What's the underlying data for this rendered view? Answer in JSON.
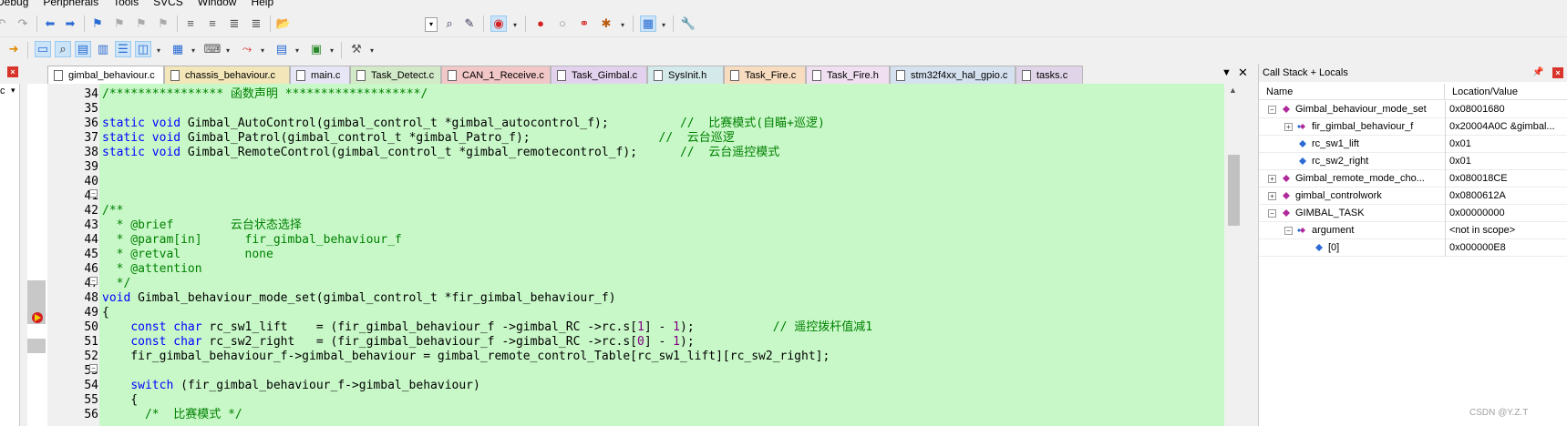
{
  "menu": [
    {
      "label": "Debug"
    },
    {
      "label": "Peripherals"
    },
    {
      "label": "Tools"
    },
    {
      "label": "SVCS"
    },
    {
      "label": "Window"
    },
    {
      "label": "Help"
    }
  ],
  "left_pane_fragment": "c",
  "tabs": [
    {
      "label": "gimbal_behaviour.c",
      "color": "#ffffff"
    },
    {
      "label": "chassis_behaviour.c",
      "color": "#f3e6b8"
    },
    {
      "label": "main.c",
      "color": "#e6e6f6"
    },
    {
      "label": "Task_Detect.c",
      "color": "#d3eac8"
    },
    {
      "label": "CAN_1_Receive.c",
      "color": "#f2c7c7"
    },
    {
      "label": "Task_Gimbal.c",
      "color": "#e3d2ee"
    },
    {
      "label": "SysInit.h",
      "color": "#d4e9e9"
    },
    {
      "label": "Task_Fire.c",
      "color": "#f8dcc0"
    },
    {
      "label": "Task_Fire.h",
      "color": "#f0dff0"
    },
    {
      "label": "stm32f4xx_hal_gpio.c",
      "color": "#d5e1ef"
    },
    {
      "label": "tasks.c",
      "color": "#e0d4e8"
    }
  ],
  "editor": {
    "lines": [
      {
        "n": "34",
        "segs": [
          {
            "t": "/**************** 函数声明 *******************/",
            "c": "cm"
          }
        ]
      },
      {
        "n": "35",
        "segs": []
      },
      {
        "n": "36",
        "segs": [
          {
            "t": "static",
            "c": "kw"
          },
          {
            "t": " "
          },
          {
            "t": "void",
            "c": "kw"
          },
          {
            "t": " Gimbal_AutoControl(gimbal_control_t *gimbal_autocontrol_f);          "
          },
          {
            "t": "//  比赛模式(自瞄+巡逻)",
            "c": "cm"
          }
        ]
      },
      {
        "n": "37",
        "segs": [
          {
            "t": "static",
            "c": "kw"
          },
          {
            "t": " "
          },
          {
            "t": "void",
            "c": "kw"
          },
          {
            "t": " Gimbal_Patrol(gimbal_control_t *gimbal_Patro_f);                  "
          },
          {
            "t": "//  云台巡逻",
            "c": "cm"
          }
        ]
      },
      {
        "n": "38",
        "segs": [
          {
            "t": "static",
            "c": "kw"
          },
          {
            "t": " "
          },
          {
            "t": "void",
            "c": "kw"
          },
          {
            "t": " Gimbal_RemoteControl(gimbal_control_t *gimbal_remotecontrol_f);      "
          },
          {
            "t": "//  云台遥控模式",
            "c": "cm"
          }
        ]
      },
      {
        "n": "39",
        "segs": []
      },
      {
        "n": "40",
        "segs": []
      },
      {
        "n": "41",
        "segs": []
      },
      {
        "n": "42",
        "segs": [
          {
            "t": "/**",
            "c": "cm"
          }
        ]
      },
      {
        "n": "43",
        "segs": [
          {
            "t": "  * @brief        云台状态选择",
            "c": "cm"
          }
        ]
      },
      {
        "n": "44",
        "segs": [
          {
            "t": "  * @param[in]      fir_gimbal_behaviour_f",
            "c": "cm"
          }
        ]
      },
      {
        "n": "45",
        "segs": [
          {
            "t": "  * @retval         none",
            "c": "cm"
          }
        ]
      },
      {
        "n": "46",
        "segs": [
          {
            "t": "  * @attention",
            "c": "cm"
          }
        ]
      },
      {
        "n": "47",
        "segs": [
          {
            "t": "  */",
            "c": "cm"
          }
        ]
      },
      {
        "n": "48",
        "segs": [
          {
            "t": "void",
            "c": "kw"
          },
          {
            "t": " Gimbal_behaviour_mode_set(gimbal_control_t *fir_gimbal_behaviour_f)"
          }
        ]
      },
      {
        "n": "49",
        "segs": [
          {
            "t": "{"
          }
        ]
      },
      {
        "n": "50",
        "segs": [
          {
            "t": "    "
          },
          {
            "t": "const",
            "c": "kw"
          },
          {
            "t": " "
          },
          {
            "t": "char",
            "c": "kw"
          },
          {
            "t": " rc_sw1_lift    = (fir_gimbal_behaviour_f ->gimbal_RC ->rc.s["
          },
          {
            "t": "1",
            "c": "nm"
          },
          {
            "t": "] - "
          },
          {
            "t": "1",
            "c": "nm"
          },
          {
            "t": ");           "
          },
          {
            "t": "// 遥控拨杆值减1",
            "c": "cm"
          }
        ]
      },
      {
        "n": "51",
        "segs": [
          {
            "t": "    "
          },
          {
            "t": "const",
            "c": "kw"
          },
          {
            "t": " "
          },
          {
            "t": "char",
            "c": "kw"
          },
          {
            "t": " rc_sw2_right   = (fir_gimbal_behaviour_f ->gimbal_RC ->rc.s["
          },
          {
            "t": "0",
            "c": "nm"
          },
          {
            "t": "] - "
          },
          {
            "t": "1",
            "c": "nm"
          },
          {
            "t": ");"
          }
        ]
      },
      {
        "n": "52",
        "segs": [
          {
            "t": "    fir_gimbal_behaviour_f->gimbal_behaviour = gimbal_remote_control_Table[rc_sw1_lift][rc_sw2_right];"
          }
        ]
      },
      {
        "n": "53",
        "segs": []
      },
      {
        "n": "54",
        "segs": [
          {
            "t": "    "
          },
          {
            "t": "switch",
            "c": "kw"
          },
          {
            "t": " (fir_gimbal_behaviour_f->gimbal_behaviour)"
          }
        ]
      },
      {
        "n": "55",
        "segs": [
          {
            "t": "    {"
          }
        ]
      },
      {
        "n": "56",
        "segs": [
          {
            "t": "      "
          },
          {
            "t": "/*  比赛模式 */",
            "c": "cm"
          }
        ]
      }
    ]
  },
  "callstack": {
    "title": "Call Stack + Locals",
    "col_name": "Name",
    "col_value": "Location/Value",
    "rows": [
      {
        "name": "Gimbal_behaviour_mode_set",
        "value": "0x08001680",
        "exp": "−",
        "ind": 0,
        "icon": "function-icon"
      },
      {
        "name": "fir_gimbal_behaviour_f",
        "value": "0x20004A0C &gimbal...",
        "exp": "+",
        "ind": 1,
        "icon": "pointer-icon"
      },
      {
        "name": "rc_sw1_lift",
        "value": "0x01",
        "exp": "",
        "ind": 1,
        "icon": "variable-icon"
      },
      {
        "name": "rc_sw2_right",
        "value": "0x01",
        "exp": "",
        "ind": 1,
        "icon": "variable-icon"
      },
      {
        "name": "Gimbal_remote_mode_cho...",
        "value": "0x080018CE",
        "exp": "+",
        "ind": 0,
        "icon": "function-icon"
      },
      {
        "name": "gimbal_controlwork",
        "value": "0x0800612A",
        "exp": "+",
        "ind": 0,
        "icon": "function-icon"
      },
      {
        "name": "GIMBAL_TASK",
        "value": "0x00000000",
        "exp": "−",
        "ind": 0,
        "icon": "function-icon"
      },
      {
        "name": "argument",
        "value": "<not in scope>",
        "exp": "−",
        "ind": 1,
        "icon": "pointer-icon"
      },
      {
        "name": "[0]",
        "value": "0x000000E8",
        "exp": "",
        "ind": 2,
        "icon": "variable-icon"
      }
    ]
  },
  "watermark": "CSDN @Y.Z.T"
}
